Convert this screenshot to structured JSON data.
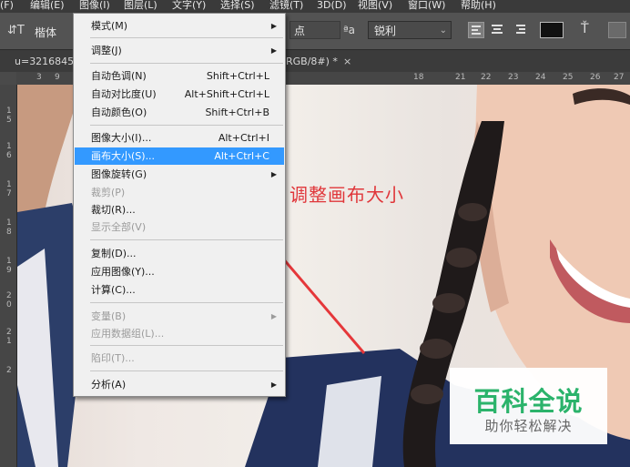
{
  "menubar": {
    "items": [
      "(F)",
      "编辑(E)",
      "图像(I)",
      "图层(L)",
      "文字(Y)",
      "选择(S)",
      "滤镜(T)",
      "3D(D)",
      "视图(V)",
      "窗口(W)",
      "帮助(H)"
    ]
  },
  "options": {
    "font_family": "楷体",
    "font_size": "点",
    "aa_label": "ªa",
    "aa_mode": "锐利"
  },
  "document": {
    "tab_left": "u=3216845",
    "tab_right": "RGB/8#) *",
    "tab_close": "×"
  },
  "rulers": {
    "h": [
      "3",
      "9",
      "18",
      "21",
      "22",
      "23",
      "24",
      "25",
      "26",
      "27"
    ],
    "v": [
      "1",
      "5",
      "1",
      "6",
      "1",
      "7",
      "1",
      "8",
      "1",
      "9",
      "2",
      "0",
      "2",
      "1",
      "2"
    ]
  },
  "menu": {
    "items": [
      {
        "label": "模式(M)",
        "submenu": "▶"
      },
      {
        "label": "调整(J)",
        "submenu": "▶"
      },
      {
        "label": "自动色调(N)",
        "shortcut": "Shift+Ctrl+L"
      },
      {
        "label": "自动对比度(U)",
        "shortcut": "Alt+Shift+Ctrl+L"
      },
      {
        "label": "自动颜色(O)",
        "shortcut": "Shift+Ctrl+B"
      },
      {
        "label": "图像大小(I)...",
        "shortcut": "Alt+Ctrl+I"
      },
      {
        "label": "画布大小(S)...",
        "shortcut": "Alt+Ctrl+C"
      },
      {
        "label": "图像旋转(G)",
        "submenu": "▶"
      },
      {
        "label": "裁剪(P)"
      },
      {
        "label": "裁切(R)..."
      },
      {
        "label": "显示全部(V)"
      },
      {
        "label": "复制(D)..."
      },
      {
        "label": "应用图像(Y)..."
      },
      {
        "label": "计算(C)..."
      },
      {
        "label": "变量(B)",
        "submenu": "▶"
      },
      {
        "label": "应用数据组(L)..."
      },
      {
        "label": "陷印(T)..."
      },
      {
        "label": "分析(A)",
        "submenu": "▶"
      }
    ]
  },
  "annotation": {
    "text": "调整画布大小",
    "color": "#e0363a"
  },
  "watermark": {
    "title": "百科全说",
    "subtitle": "助你轻松解决",
    "color": "#2bb36b"
  },
  "colors": {
    "highlight": "#3399ff",
    "arrow": "#e5373a"
  }
}
